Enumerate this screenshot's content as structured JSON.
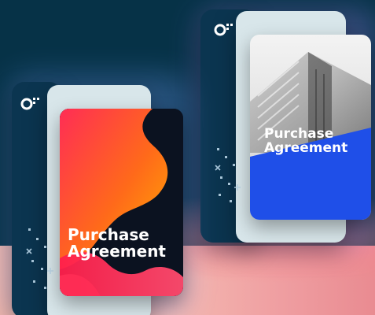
{
  "documents": [
    {
      "title": "Purchase Agreement",
      "cover_style": "abstract-gradient",
      "colors": {
        "spine": "#0b3550",
        "paper": "#d8e6ea",
        "blob_top": "#ff2d55",
        "blob_mid": "#ff6a1a",
        "blob_bottom": "#ffb000",
        "dark": "#0b1220"
      }
    },
    {
      "title": "Purchase Agreement",
      "cover_style": "photo-building",
      "colors": {
        "spine": "#0b3550",
        "paper": "#d8e6ea",
        "accent": "#1f4fe8",
        "photo": "#bdbdbd"
      }
    }
  ],
  "icons": [
    "logo-mark-icon",
    "sparkle-dots-icon"
  ],
  "scene_colors": {
    "background": "#063247",
    "floor": "#f4b9b1"
  }
}
